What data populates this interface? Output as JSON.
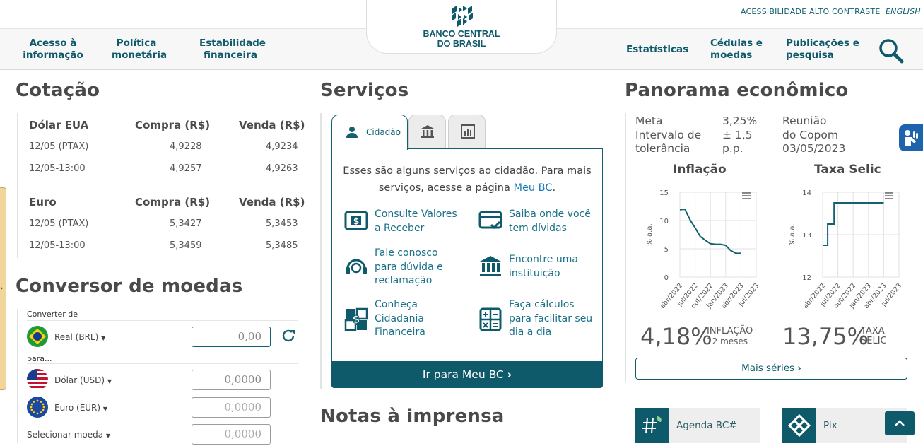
{
  "header": {
    "top_links": [
      "ACESSIBILIDADE",
      "ALTO CONTRASTE",
      "ENGLISH"
    ],
    "logo_line1": "BANCO CENTRAL",
    "logo_line2": "DO BRASIL",
    "nav_left": [
      {
        "line1": "Acesso à",
        "line2": "informação"
      },
      {
        "line1": "Política",
        "line2": "monetária"
      },
      {
        "line1": "Estabilidade",
        "line2": "financeira"
      }
    ],
    "nav_right": [
      {
        "line1": "Estatísticas",
        "line2": ""
      },
      {
        "line1": "Cédulas e",
        "line2": "moedas"
      },
      {
        "line1": "Publicações e",
        "line2": "pesquisa"
      }
    ],
    "search_icon": "search-icon"
  },
  "cotacao": {
    "title": "Cotação",
    "tables": [
      {
        "currency": "Dólar EUA",
        "col_buy": "Compra (R$)",
        "col_sell": "Venda (R$)",
        "rows": [
          {
            "label": "12/05 (PTAX)",
            "buy": "4,9228",
            "sell": "4,9234"
          },
          {
            "label": "12/05-13:00",
            "buy": "4,9257",
            "sell": "4,9263"
          }
        ]
      },
      {
        "currency": "Euro",
        "col_buy": "Compra (R$)",
        "col_sell": "Venda (R$)",
        "rows": [
          {
            "label": "12/05 (PTAX)",
            "buy": "5,3427",
            "sell": "5,3453"
          },
          {
            "label": "12/05-13:00",
            "buy": "5,3459",
            "sell": "5,3485"
          }
        ]
      }
    ]
  },
  "conversor": {
    "title": "Conversor de moedas",
    "from_label": "Converter de",
    "from_currency": "Real (BRL)",
    "from_value": "0,00",
    "to_label": "para...",
    "to": [
      {
        "currency": "Dólar (USD)",
        "value": "0,0000"
      },
      {
        "currency": "Euro (EUR)",
        "value": "0,0000"
      },
      {
        "currency": "Selecionar moeda",
        "value": "0,0000"
      }
    ]
  },
  "servicos": {
    "title": "Serviços",
    "tabs": [
      {
        "label": "Cidadão",
        "icon": "person-icon",
        "active": true
      },
      {
        "label": "",
        "icon": "bank-icon",
        "active": false
      },
      {
        "label": "",
        "icon": "chart-icon",
        "active": false
      }
    ],
    "intro_before": "Esses são alguns serviços ao cidadão. Para mais serviços, acesse a página ",
    "intro_link": "Meu BC",
    "intro_after": ".",
    "items": [
      {
        "lines": [
          "Consulte Valores",
          "a Receber"
        ],
        "icon": "money-note-icon"
      },
      {
        "lines": [
          "Saiba onde você",
          "tem dívidas"
        ],
        "icon": "card-check-icon"
      },
      {
        "lines": [
          "Fale conosco",
          "para dúvida e",
          "reclamação"
        ],
        "icon": "headset-icon"
      },
      {
        "lines": [
          "Encontre uma",
          "instituição"
        ],
        "icon": "institution-icon"
      },
      {
        "lines": [
          "Conheça",
          "Cidadania",
          "Financeira"
        ],
        "icon": "citizenship-icon"
      },
      {
        "lines": [
          "Faça cálculos",
          "para facilitar seu",
          "dia a dia"
        ],
        "icon": "calculator-icon"
      }
    ],
    "button": "Ir para Meu BC"
  },
  "panorama": {
    "title": "Panorama econômico",
    "meta_label": [
      "Meta",
      "Intervalo de",
      "tolerância"
    ],
    "meta_values": [
      "3,25%",
      "± 1,5",
      "p.p."
    ],
    "reuniao": [
      "Reunião",
      "do Copom",
      "03/05/2023"
    ],
    "inflacao_value": "4,18%",
    "inflacao_label": [
      "INFLAÇÃO",
      "12 meses"
    ],
    "selic_value": "13,75%",
    "selic_label": [
      "TAXA",
      "SELIC"
    ],
    "mais_series": "Mais séries",
    "cards": [
      {
        "label": "Agenda BC#",
        "icon": "agenda-icon"
      },
      {
        "label": "Pix",
        "icon": "pix-icon"
      }
    ]
  },
  "notas": {
    "title": "Notas à imprensa"
  },
  "chart_data": [
    {
      "type": "line",
      "title": "Inflação",
      "ylabel": "% a.a.",
      "yticks": [
        0,
        5,
        10,
        15
      ],
      "ylim": [
        0,
        15
      ],
      "xticks": [
        "abr/2022",
        "jul/2022",
        "out/2022",
        "jan/2023",
        "abr/2023",
        "jul/2023"
      ],
      "x": [
        0.0,
        0.33,
        0.67,
        1.0,
        1.33,
        1.67,
        2.0,
        2.33,
        2.67,
        3.0,
        3.33,
        3.67,
        4.0
      ],
      "values": [
        11.9,
        12.0,
        10.1,
        8.7,
        7.2,
        6.5,
        5.9,
        5.8,
        5.8,
        5.6,
        4.7,
        4.2,
        4.2
      ],
      "grid": true,
      "series_color": "#11616f"
    },
    {
      "type": "line",
      "title": "Taxa Selic",
      "ylabel": "% a.a.",
      "yticks": [
        12,
        13,
        14
      ],
      "ylim": [
        12,
        14
      ],
      "xticks": [
        "abr/2022",
        "jul/2022",
        "out/2022",
        "jan/2023",
        "abr/2023",
        "jul/2023"
      ],
      "x": [
        0.0,
        0.33,
        0.33,
        0.75,
        0.75,
        1.0,
        1.0,
        4.0
      ],
      "values": [
        12.75,
        12.75,
        13.25,
        13.25,
        13.75,
        13.75,
        13.75,
        13.75
      ],
      "grid": true,
      "series_color": "#11616f"
    }
  ]
}
